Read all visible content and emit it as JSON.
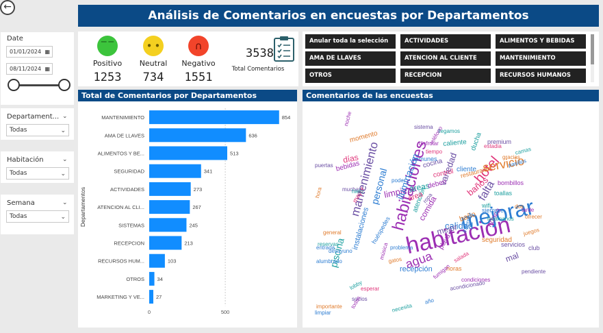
{
  "header": {
    "title": "Análisis de Comentarios en encuestas por Departamentos"
  },
  "filters": {
    "date_label": "Date",
    "date_from": "01/01/2024",
    "date_to": "08/11/2024",
    "departamento_label": "Departament...",
    "departamento_value": "Todas",
    "habitacion_label": "Habitación",
    "habitacion_value": "Todas",
    "semana_label": "Semana",
    "semana_value": "Todas"
  },
  "sentiment": {
    "positivo_label": "Positivo",
    "positivo_count": "1253",
    "neutral_label": "Neutral",
    "neutral_count": "734",
    "negativo_label": "Negativo",
    "negativo_count": "1551",
    "total_value": "3538",
    "total_label": "Total Comentarios"
  },
  "colors": {
    "accent": "#0b4a86",
    "bar": "#118dff",
    "positive": "#3cc43c",
    "neutral": "#f4d020",
    "negative": "#f2442a"
  },
  "slicer": {
    "items": [
      "Anular toda la selección",
      "ACTIVIDADES",
      "ALIMENTOS Y BEBIDAS",
      "AMA DE LLAVES",
      "ATENCION AL CLIENTE",
      "MANTENIMIENTO",
      "OTROS",
      "RECEPCION",
      "RECURSOS HUMANOS"
    ]
  },
  "chart_section": {
    "title": "Total de Comentarios por Departamentos"
  },
  "wordcloud_section": {
    "title": "Comentarios de las encuestas"
  },
  "chart_data": {
    "type": "bar",
    "orientation": "horizontal",
    "categories": [
      "MANTENIMIENTO",
      "AMA DE LLAVES",
      "ALIMENTOS Y BE...",
      "SEGURIDAD",
      "ACTIVIDADES",
      "ATENCION AL CLI...",
      "SISTEMAS",
      "RECEPCION",
      "RECURSOS HUM...",
      "OTROS",
      "MARKETING Y VE..."
    ],
    "values": [
      854,
      636,
      513,
      341,
      273,
      267,
      245,
      213,
      103,
      34,
      27
    ],
    "ylabel": "Departamentos",
    "xlim": [
      0,
      900
    ],
    "xticks": [
      "0",
      "500"
    ],
    "grid": true
  },
  "wordcloud": {
    "words": [
      {
        "t": "habitación",
        "c": "#9c2fb3"
      },
      {
        "t": "mejorar",
        "c": "#2d7dd2"
      },
      {
        "t": "habitaciones",
        "c": "#9c2fb3"
      },
      {
        "t": "hotel",
        "c": "#e0357a"
      },
      {
        "t": "servicio",
        "c": "#e07b2c"
      },
      {
        "t": "mantenimiento",
        "c": "#6a4ea3"
      },
      {
        "t": "agua",
        "c": "#9c2fb3"
      },
      {
        "t": "piscina",
        "c": "#1ea0a0"
      },
      {
        "t": "falta",
        "c": "#6a4ea3"
      },
      {
        "t": "personal",
        "c": "#2d7dd2"
      },
      {
        "t": "limpieza",
        "c": "#9c2fb3"
      },
      {
        "t": "iluminación",
        "c": "#2d7dd2"
      },
      {
        "t": "variedad",
        "c": "#6a4ea3"
      },
      {
        "t": "baños",
        "c": "#e0357a"
      },
      {
        "t": "áreas",
        "c": "#1ea0a0"
      },
      {
        "t": "comida",
        "c": "#9c2fb3"
      },
      {
        "t": "calidad",
        "c": "#2d7dd2"
      },
      {
        "t": "mejor",
        "c": "#6a4ea3"
      },
      {
        "t": "baño",
        "c": "#e07b2c"
      },
      {
        "t": "recepción",
        "c": "#2d7dd2"
      },
      {
        "t": "días",
        "c": "#e0357a"
      },
      {
        "t": "nunca",
        "c": "#9c2fb3"
      },
      {
        "t": "atención",
        "c": "#1ea0a0"
      },
      {
        "t": "instalaciones",
        "c": "#2d7dd2"
      },
      {
        "t": "mal",
        "c": "#6a4ea3"
      },
      {
        "t": "cliente",
        "c": "#2d7dd2"
      },
      {
        "t": "área",
        "c": "#e0357a"
      },
      {
        "t": "caliente",
        "c": "#1ea0a0"
      },
      {
        "t": "bebidas",
        "c": "#9c2fb3"
      },
      {
        "t": "restaurante",
        "c": "#e07b2c"
      },
      {
        "t": "momento",
        "c": "#e07b2c"
      },
      {
        "t": "playa",
        "c": "#9c2fb3"
      },
      {
        "t": "ducha",
        "c": "#1ea0a0"
      },
      {
        "t": "cocina",
        "c": "#6a4ea3"
      },
      {
        "t": "seguridad",
        "c": "#e07b2c"
      },
      {
        "t": "servicios",
        "c": "#6a4ea3"
      },
      {
        "t": "comunes",
        "c": "#2d7dd2"
      },
      {
        "t": "control",
        "c": "#e0357a"
      },
      {
        "t": "deben",
        "c": "#9c2fb3"
      },
      {
        "t": "internet",
        "c": "#2d7dd2"
      },
      {
        "t": "premium",
        "c": "#6a4ea3"
      },
      {
        "t": "toallas",
        "c": "#1ea0a0"
      },
      {
        "t": "bombillos",
        "c": "#9c2fb3"
      },
      {
        "t": "horas",
        "c": "#e07b2c"
      },
      {
        "t": "huéspedes",
        "c": "#2d7dd2"
      },
      {
        "t": "mayor",
        "c": "#e0357a"
      },
      {
        "t": "wifi",
        "c": "#1ea0a0"
      },
      {
        "t": "club",
        "c": "#6a4ea3"
      },
      {
        "t": "general",
        "c": "#e07b2c"
      },
      {
        "t": "desayuno",
        "c": "#2d7dd2"
      },
      {
        "t": "condiciones",
        "c": "#9c2fb3"
      },
      {
        "t": "lavamanos",
        "c": "#1ea0a0"
      },
      {
        "t": "juegos",
        "c": "#e07b2c"
      },
      {
        "t": "pendiente",
        "c": "#6a4ea3"
      },
      {
        "t": "alumbrado",
        "c": "#2d7dd2"
      },
      {
        "t": "música",
        "c": "#9c2fb3"
      },
      {
        "t": "estadia",
        "c": "#e0357a"
      },
      {
        "t": "pasillos",
        "c": "#2d7dd2"
      },
      {
        "t": "gracias",
        "c": "#e07b2c"
      },
      {
        "t": "sistema",
        "c": "#6a4ea3"
      },
      {
        "t": "llegamos",
        "c": "#1ea0a0"
      },
      {
        "t": "fumigan",
        "c": "#9c2fb3"
      },
      {
        "t": "gatos",
        "c": "#e07b2c"
      },
      {
        "t": "entrada",
        "c": "#2d7dd2"
      },
      {
        "t": "puertas",
        "c": "#6a4ea3"
      },
      {
        "t": "necesita",
        "c": "#1ea0a0"
      },
      {
        "t": "tarde",
        "c": "#9c2fb3"
      },
      {
        "t": "ofrecer",
        "c": "#e07b2c"
      },
      {
        "t": "limpiar",
        "c": "#2d7dd2"
      },
      {
        "t": "socios",
        "c": "#6a4ea3"
      },
      {
        "t": "esperar",
        "c": "#e0357a"
      },
      {
        "t": "reservas",
        "c": "#1ea0a0"
      },
      {
        "t": "disfrutar",
        "c": "#9c2fb3"
      },
      {
        "t": "año",
        "c": "#2d7dd2"
      },
      {
        "t": "acondicionado",
        "c": "#6a4ea3"
      },
      {
        "t": "hora",
        "c": "#e07b2c"
      },
      {
        "t": "lobby",
        "c": "#1ea0a0"
      },
      {
        "t": "poder",
        "c": "#2d7dd2"
      },
      {
        "t": "noche",
        "c": "#9c2fb3"
      },
      {
        "t": "tiempo",
        "c": "#e0357a"
      },
      {
        "t": "muchas",
        "c": "#6a4ea3"
      },
      {
        "t": "siempre",
        "c": "#2d7dd2"
      },
      {
        "t": "camas",
        "c": "#1ea0a0"
      },
      {
        "t": "importante",
        "c": "#e07b2c"
      },
      {
        "t": "teléfono",
        "c": "#9c2fb3"
      },
      {
        "t": "ropa",
        "c": "#6a4ea3"
      },
      {
        "t": "problema",
        "c": "#2d7dd2"
      },
      {
        "t": "hielo",
        "c": "#1ea0a0"
      },
      {
        "t": "salada",
        "c": "#e0357a"
      },
      {
        "t": "todas",
        "c": "#9c2fb3"
      },
      {
        "t": "dos",
        "c": "#e07b2c"
      }
    ]
  }
}
